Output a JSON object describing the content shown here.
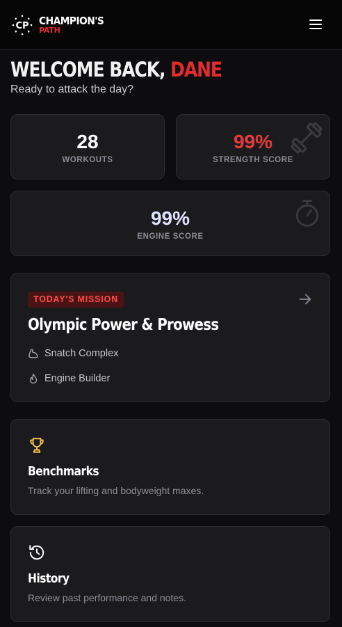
{
  "header": {
    "brand_top": "CHAMPION'S",
    "brand_bottom": "PATH",
    "logo_text": "CP",
    "menu_icon": "hamburger-menu-icon"
  },
  "welcome": {
    "greeting": "WELCOME BACK,",
    "name": "DANE",
    "subtitle": "Ready to attack the day?"
  },
  "stats": {
    "workouts": {
      "value": "28",
      "label": "WORKOUTS"
    },
    "strength": {
      "value": "99%",
      "label": "STRENGTH SCORE",
      "icon": "dumbbell-icon"
    },
    "engine": {
      "value": "99%",
      "label": "ENGINE SCORE",
      "icon": "stopwatch-icon"
    }
  },
  "mission": {
    "badge": "TODAY'S MISSION",
    "title": "Olympic Power & Prowess",
    "items": [
      {
        "icon": "bicep-icon",
        "label": "Snatch Complex"
      },
      {
        "icon": "flame-icon",
        "label": "Engine Builder"
      }
    ],
    "arrow_icon": "arrow-right-icon"
  },
  "benchmarks": {
    "icon": "trophy-icon",
    "title": "Benchmarks",
    "description": "Track your lifting and bodyweight maxes."
  },
  "history": {
    "icon": "history-icon",
    "title": "History",
    "description": "Review past performance and notes."
  },
  "colors": {
    "accent_red": "#e32b2b",
    "trophy_yellow": "#f5c242",
    "engine_value": "#dfe3ff",
    "background": "#0d0d0f",
    "card": "#1b1b1e"
  }
}
